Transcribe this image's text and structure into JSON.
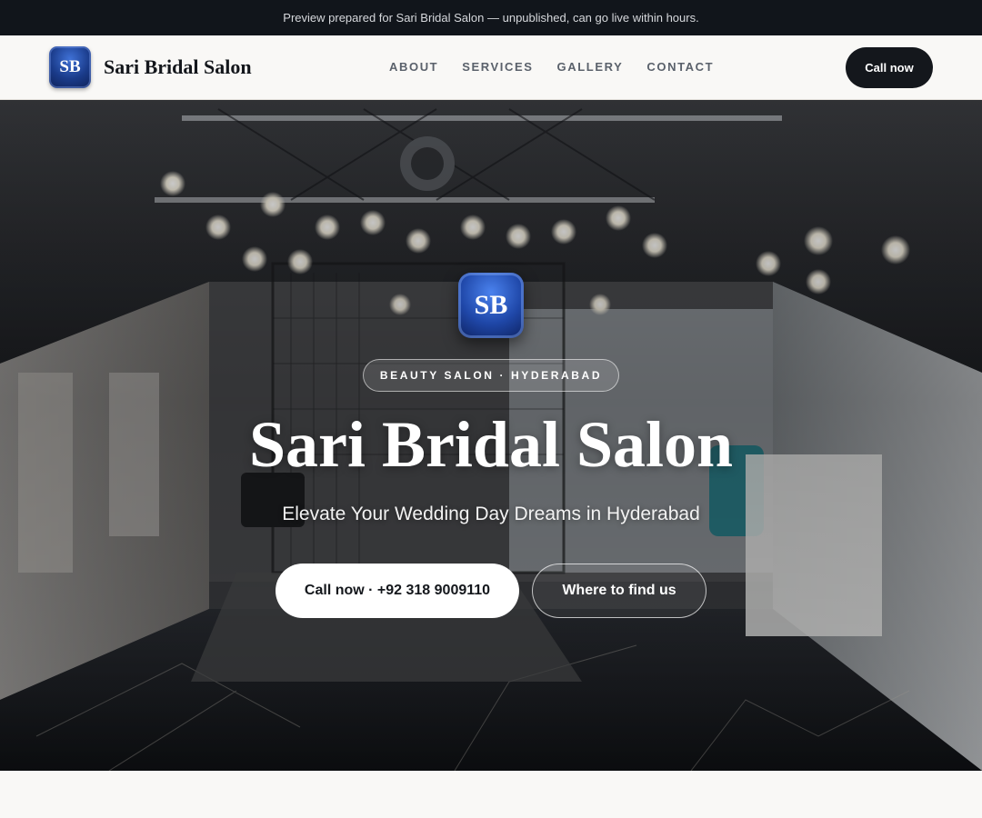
{
  "preview_bar": {
    "text": "Preview prepared for Sari Bridal Salon — unpublished, can go live within hours."
  },
  "header": {
    "logo_initials": "SB",
    "brand_name": "Sari Bridal Salon",
    "nav": [
      {
        "label": "ABOUT"
      },
      {
        "label": "SERVICES"
      },
      {
        "label": "GALLERY"
      },
      {
        "label": "CONTACT"
      }
    ],
    "cta_label": "Call now"
  },
  "hero": {
    "logo_initials": "SB",
    "badge": "BEAUTY SALON · HYDERABAD",
    "title": "Sari Bridal Salon",
    "tagline": "Elevate Your Wedding Day Dreams in Hyderabad",
    "primary_button": "Call now · +92 318 9009110",
    "secondary_button": "Where to find us",
    "background_image": "salon-interior-photo"
  },
  "colors": {
    "dark": "#14171c",
    "page_background": "#f9f8f6",
    "brand_blue": "#1f47a8"
  }
}
